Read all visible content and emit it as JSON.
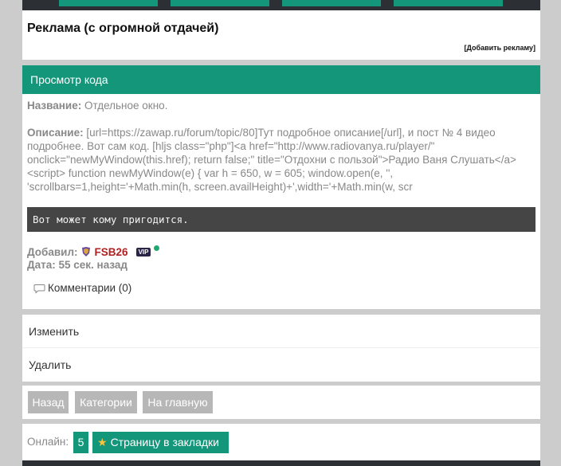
{
  "ads": {
    "title": "Реклама (с огромной отдачей)",
    "add_link": "[Добавить рекламу]"
  },
  "code_view": {
    "header": "Просмотр кода",
    "name_label": "Название:",
    "name_value": " Отдельное окно.",
    "desc_label": "Описание:",
    "desc_value": " [url=https://zawap.ru/forum/topic/80]Тут подробное описание[/url], и пост № 4 видео подробнее. Вот сам код. [hljs class=\"php\"]<a href=\"http://www.radiovanya.ru/player/\" onclick=\"newMyWindow(this.href); return false;\" title=\"Отдохни с пользой\">Радио Ваня Слушать</a> <script> function newMyWindow(e) { var h = 650, w = 605; window.open(e, '', 'scrollbars=1,height='+Math.min(h, screen.availHeight)+',width='+Math.min(w, scr",
    "quote": "Вот может кому пригодится.",
    "added_label": "Добавил:",
    "author": "FSB26",
    "vip_badge": "VIP",
    "date_label": "Дата:",
    "date_value": "55 сек. назад",
    "comments": "Комментарии (0)"
  },
  "actions": {
    "edit": "Изменить",
    "delete": "Удалить"
  },
  "nav": {
    "back": "Назад",
    "categories": "Категории",
    "home": "На главную"
  },
  "footer": {
    "online_label": "Онлайн:",
    "online_count": "5",
    "bookmark": "Страницу в закладки"
  },
  "colors": {
    "accent": "#14967a",
    "dark": "#2c3035",
    "quote_bg": "#454545",
    "author": "#b12121"
  }
}
